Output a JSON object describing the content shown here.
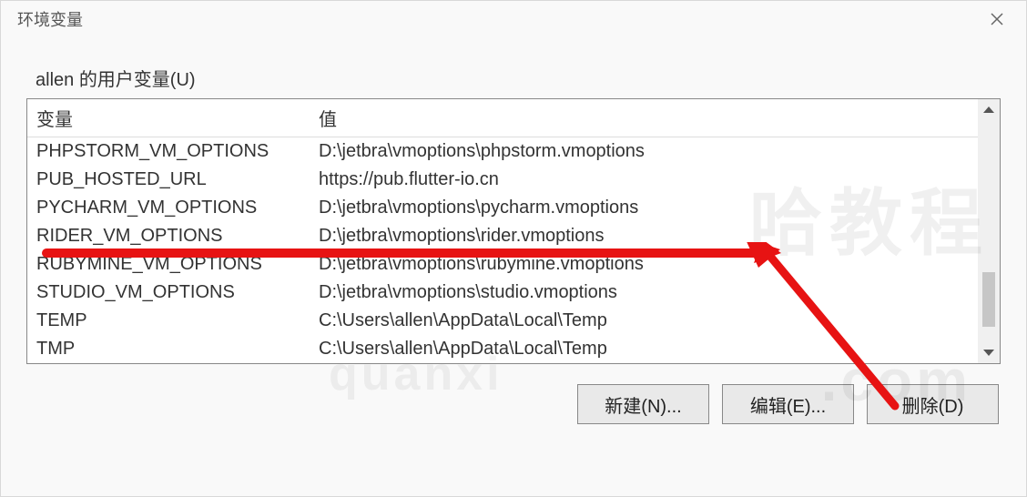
{
  "window": {
    "title": "环境变量"
  },
  "group": {
    "label": "allen 的用户变量(U)"
  },
  "table": {
    "header_var": "变量",
    "header_val": "值",
    "rows": [
      {
        "var": "PHPSTORM_VM_OPTIONS",
        "val": "D:\\jetbra\\vmoptions\\phpstorm.vmoptions"
      },
      {
        "var": "PUB_HOSTED_URL",
        "val": "https://pub.flutter-io.cn"
      },
      {
        "var": "PYCHARM_VM_OPTIONS",
        "val": "D:\\jetbra\\vmoptions\\pycharm.vmoptions"
      },
      {
        "var": "RIDER_VM_OPTIONS",
        "val": "D:\\jetbra\\vmoptions\\rider.vmoptions"
      },
      {
        "var": "RUBYMINE_VM_OPTIONS",
        "val": "D:\\jetbra\\vmoptions\\rubymine.vmoptions"
      },
      {
        "var": "STUDIO_VM_OPTIONS",
        "val": "D:\\jetbra\\vmoptions\\studio.vmoptions"
      },
      {
        "var": "TEMP",
        "val": "C:\\Users\\allen\\AppData\\Local\\Temp"
      },
      {
        "var": "TMP",
        "val": "C:\\Users\\allen\\AppData\\Local\\Temp"
      }
    ]
  },
  "buttons": {
    "new": "新建(N)...",
    "edit": "编辑(E)...",
    "delete": "删除(D)"
  },
  "watermarks": {
    "w1": "哈教程",
    "w2": ".com",
    "w3": "quanxi"
  }
}
